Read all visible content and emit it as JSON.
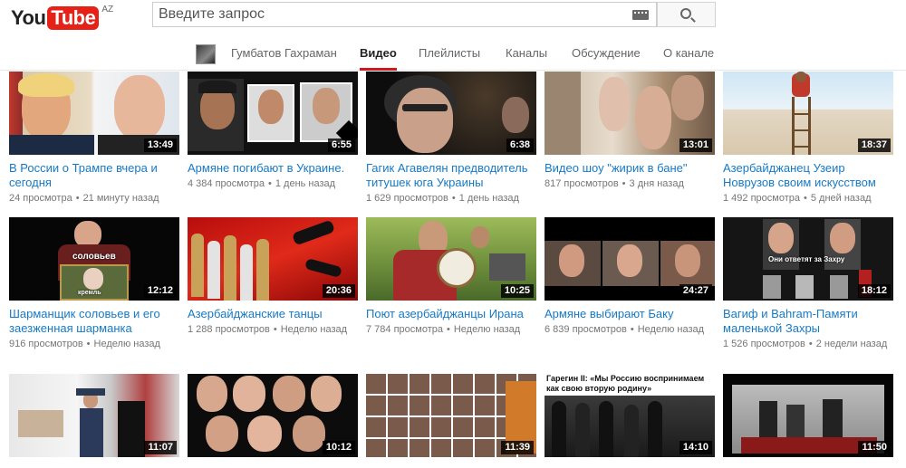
{
  "masthead": {
    "logo_you": "You",
    "logo_tube": "Tube",
    "logo_region": "AZ",
    "search_placeholder": "Введите запрос",
    "search_icon": "magnifier-icon",
    "keyboard_icon": "keyboard-icon"
  },
  "channel": {
    "name": "Гумбатов Гахраман",
    "tabs": [
      {
        "label": "Видео",
        "active": true
      },
      {
        "label": "Плейлисты",
        "active": false
      },
      {
        "label": "Каналы",
        "active": false
      },
      {
        "label": "Обсуждение",
        "active": false
      },
      {
        "label": "О канале",
        "active": false
      }
    ]
  },
  "videos": [
    {
      "title": "В России о Трампе вчера и сегодня",
      "views": "24 просмотра",
      "age": "21 минуту назад",
      "duration": "13:49"
    },
    {
      "title": "Армяне погибают в Украине.",
      "views": "4 384 просмотра",
      "age": "1 день назад",
      "duration": "6:55"
    },
    {
      "title": "Гагик Агавелян предводитель титушек юга Украины",
      "views": "1 629 просмотров",
      "age": "1 день назад",
      "duration": "6:38"
    },
    {
      "title": "Видео шоу \"жирик в бане\"",
      "views": "817 просмотров",
      "age": "3 дня назад",
      "duration": "13:01"
    },
    {
      "title": "Азербайджанец Узеир Новрузов своим искусством",
      "views": "1 492 просмотра",
      "age": "5 дней назад",
      "duration": "18:37"
    },
    {
      "title": "Шарманщик соловьев и его заезженная шарманка",
      "views": "916 просмотров",
      "age": "Неделю назад",
      "duration": "12:12",
      "overlay": "соловьев",
      "overlay2": "кремль"
    },
    {
      "title": "Азербайджанские танцы",
      "views": "1 288 просмотров",
      "age": "Неделю назад",
      "duration": "20:36"
    },
    {
      "title": "Поют азербайджанцы Ирана",
      "views": "7 784 просмотра",
      "age": "Неделю назад",
      "duration": "10:25"
    },
    {
      "title": "Армяне выбирают Баку",
      "views": "6 839 просмотров",
      "age": "Неделю назад",
      "duration": "24:27"
    },
    {
      "title": "Вагиф и Bahram-Памяти маленькой Захры",
      "views": "1 526 просмотров",
      "age": "2 недели назад",
      "duration": "18:12",
      "overlay": "Они ответят за Захру"
    },
    {
      "title": "",
      "views": "",
      "age": "",
      "duration": "11:07"
    },
    {
      "title": "",
      "views": "",
      "age": "",
      "duration": "10:12"
    },
    {
      "title": "",
      "views": "",
      "age": "",
      "duration": "11:39"
    },
    {
      "title": "",
      "views": "",
      "age": "",
      "duration": "14:10",
      "overlay": "Гарегин II: «Мы Россию воспринимаем",
      "overlay2": "как свою вторую родину»"
    },
    {
      "title": "",
      "views": "",
      "age": "",
      "duration": "11:50"
    }
  ],
  "colors": {
    "brand_red": "#e62117",
    "link_blue": "#167ac6",
    "tab_underline": "#cc181e",
    "meta_gray": "#767676"
  }
}
